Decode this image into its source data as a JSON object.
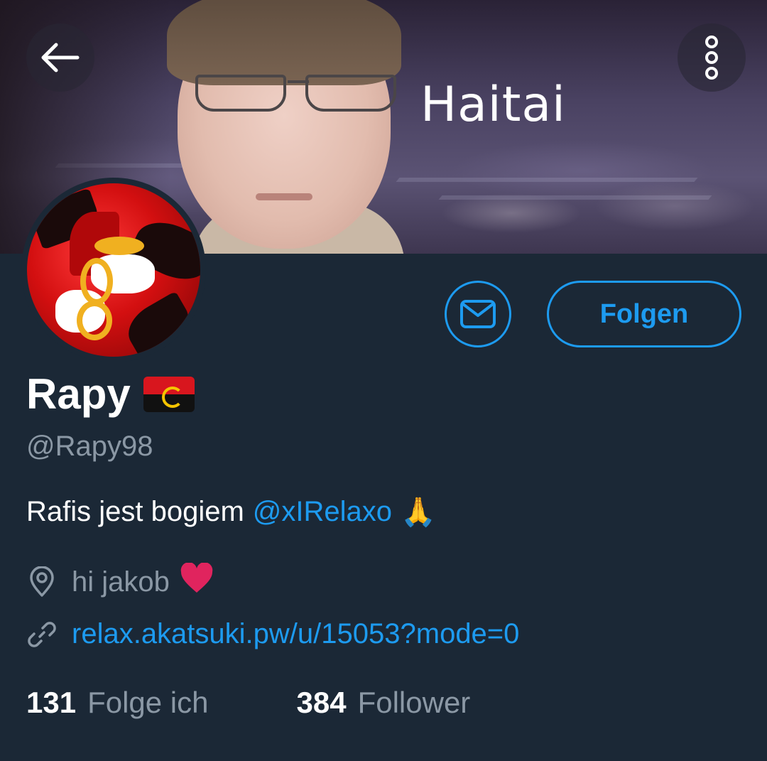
{
  "header": {
    "banner_caption": "Haitai",
    "back_icon": "arrow-left-icon",
    "more_icon": "more-vertical-icon"
  },
  "profile": {
    "display_name": "Rapy",
    "flag_emoji": "angola-flag",
    "handle": "@Rapy98",
    "bio_text": "Rafis jest bogiem",
    "bio_mention": "@xIRelaxo",
    "bio_emoji": "🙏",
    "location": "hi jakob",
    "location_emoji": "❤️",
    "website": "relax.akatsuki.pw/u/15053?mode=0"
  },
  "actions": {
    "message_icon": "envelope-icon",
    "follow_label": "Folgen"
  },
  "stats": {
    "following_count": "131",
    "following_label": "Folge ich",
    "followers_count": "384",
    "followers_label": "Follower"
  },
  "colors": {
    "background": "#1b2836",
    "accent": "#1d9bf0",
    "muted_text": "#8b98a5"
  }
}
